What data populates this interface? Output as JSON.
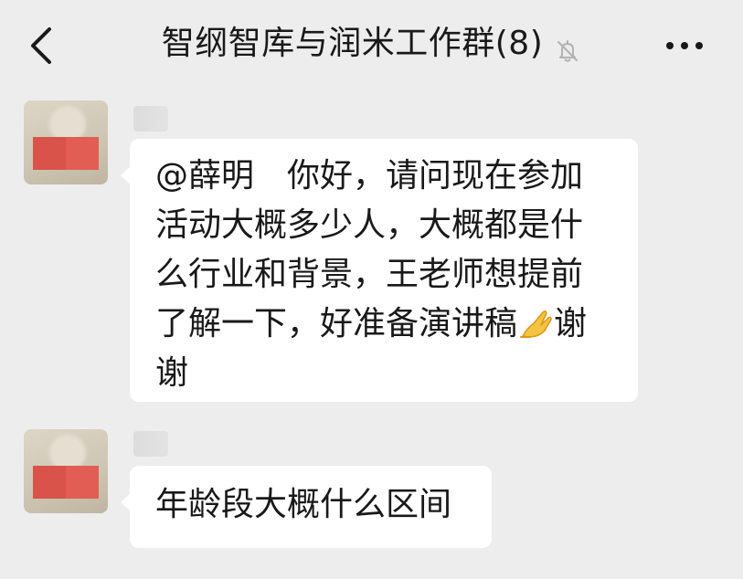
{
  "header": {
    "title": "智纲智库与润米工作群(8)",
    "back_icon": "chevron-left-icon",
    "mute_icon": "bell-off-icon",
    "more_icon": "more-dots-icon"
  },
  "messages": [
    {
      "lines": [
        "@薛明　你好，请问现在参加",
        "活动大概多少人，大概都是什",
        "么行业和背景，王老师想提前",
        "了解一下，好准备演讲稿",
        "谢"
      ],
      "emoji": "folded-hands-icon",
      "line4_tail": "谢"
    },
    {
      "lines": [
        "年龄段大概什么区间"
      ]
    }
  ],
  "colors": {
    "background": "#ededed",
    "bubble": "#ffffff",
    "text": "#191919",
    "redaction": "#d9534a"
  }
}
